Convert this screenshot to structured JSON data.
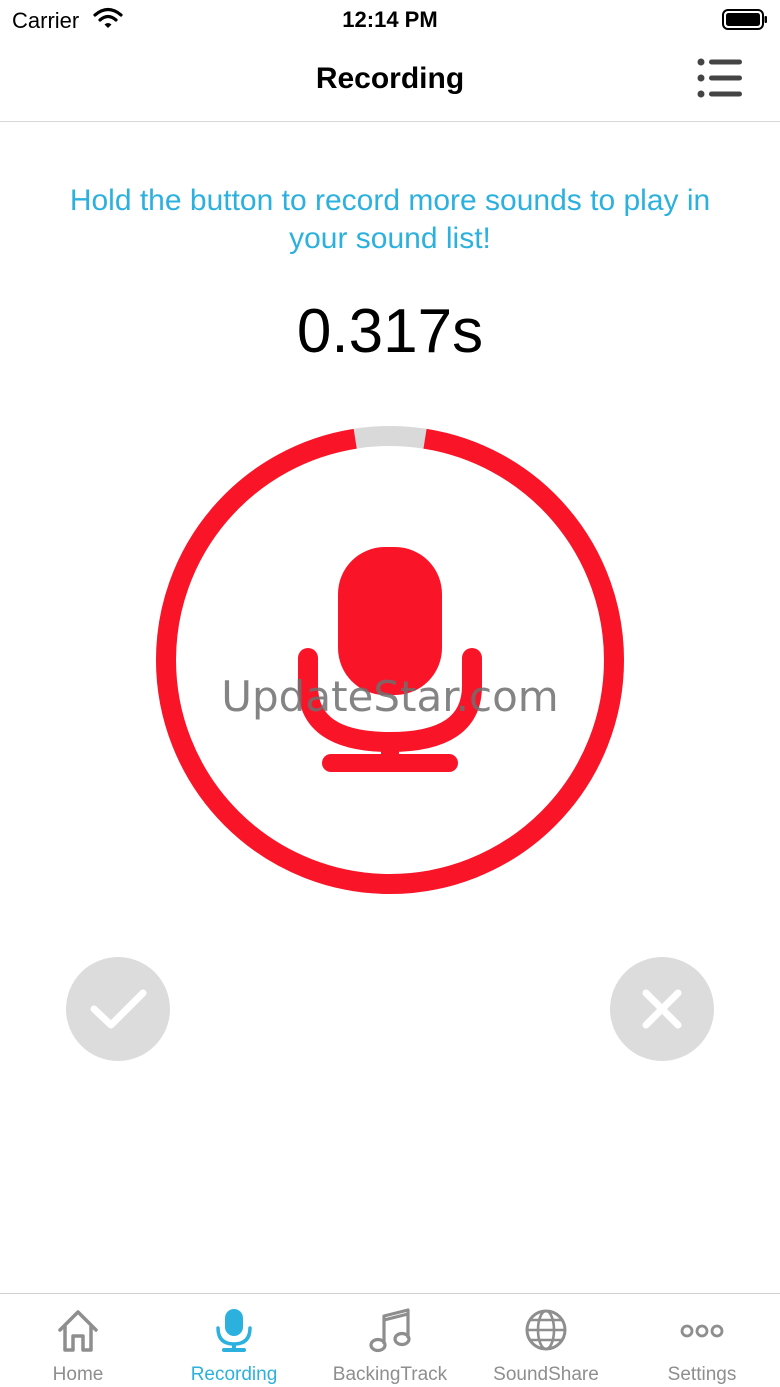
{
  "status_bar": {
    "carrier": "Carrier",
    "time": "12:14 PM"
  },
  "nav": {
    "title": "Recording",
    "menu_icon": "list-icon"
  },
  "instructions": "Hold the button to record more sounds to play in your sound list!",
  "timer": "0.317s",
  "record": {
    "progress": 0.95,
    "accent_color": "#fa1428",
    "track_color": "#d9d9d9",
    "icon": "microphone-icon"
  },
  "watermark": "UpdateStar.com",
  "actions": {
    "confirm_icon": "checkmark-icon",
    "cancel_icon": "close-icon"
  },
  "tabs": [
    {
      "label": "Home",
      "icon": "home-icon"
    },
    {
      "label": "Recording",
      "icon": "microphone-icon",
      "active": true
    },
    {
      "label": "BackingTrack",
      "icon": "music-note-icon"
    },
    {
      "label": "SoundShare",
      "icon": "globe-icon"
    },
    {
      "label": "Settings",
      "icon": "more-icon"
    }
  ],
  "colors": {
    "brand_blue": "#2cb1df",
    "inactive_gray": "#8e8e8e"
  }
}
